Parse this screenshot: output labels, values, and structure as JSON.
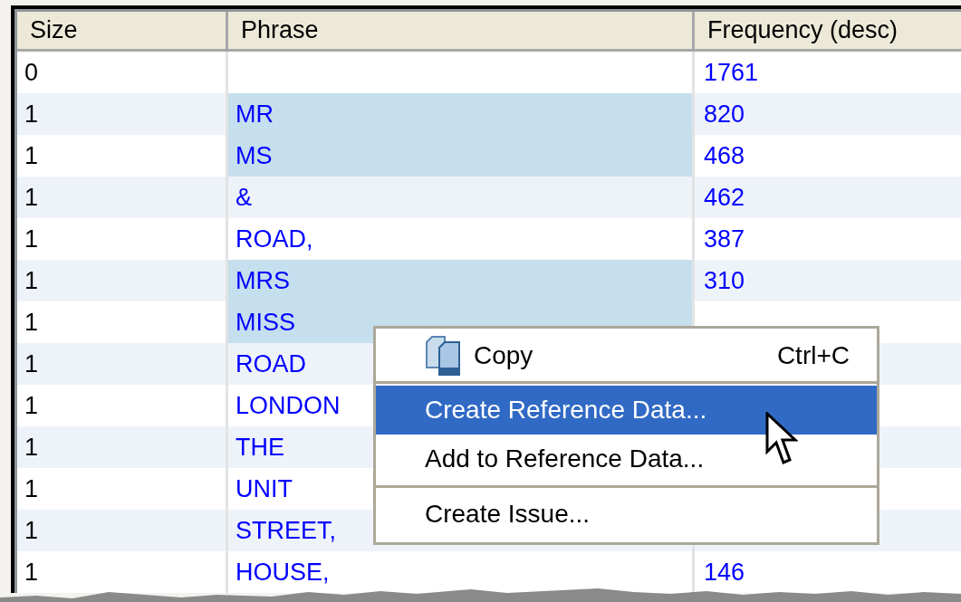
{
  "columns": [
    {
      "label": "Size"
    },
    {
      "label": "Phrase"
    },
    {
      "label": "Frequency (desc)"
    }
  ],
  "rows": [
    {
      "size": "0",
      "frequency": "1761",
      "selected": false
    },
    {
      "size": "1",
      "phrase": "MR",
      "frequency": "820",
      "selected": true
    },
    {
      "size": "1",
      "phrase": "MS",
      "frequency": "468",
      "selected": true
    },
    {
      "size": "1",
      "phrase": "&",
      "frequency": "462",
      "selected": false
    },
    {
      "size": "1",
      "phrase": "ROAD,",
      "frequency": "387",
      "selected": false
    },
    {
      "size": "1",
      "phrase": "MRS",
      "frequency": "310",
      "selected": true
    },
    {
      "size": "1",
      "phrase": "MISS",
      "selected": true
    },
    {
      "size": "1",
      "phrase": "ROAD",
      "selected": false
    },
    {
      "size": "1",
      "phrase": "LONDON",
      "selected": false
    },
    {
      "size": "1",
      "phrase": "THE",
      "selected": false
    },
    {
      "size": "1",
      "phrase": "UNIT",
      "selected": false
    },
    {
      "size": "1",
      "phrase": "STREET,",
      "selected": false
    },
    {
      "size": "1",
      "phrase": "HOUSE,",
      "frequency": "146",
      "selected": false
    }
  ],
  "context_menu": {
    "groups": [
      [
        {
          "label": "Copy",
          "shortcut": "Ctrl+C",
          "kind": "copy",
          "selected": false
        }
      ],
      [
        {
          "label": "Create Reference Data...",
          "kind": "plain",
          "selected": true
        },
        {
          "label": "Add to Reference Data...",
          "kind": "plain",
          "selected": false
        }
      ],
      [
        {
          "label": "Create Issue...",
          "kind": "plain",
          "selected": false
        }
      ]
    ]
  }
}
